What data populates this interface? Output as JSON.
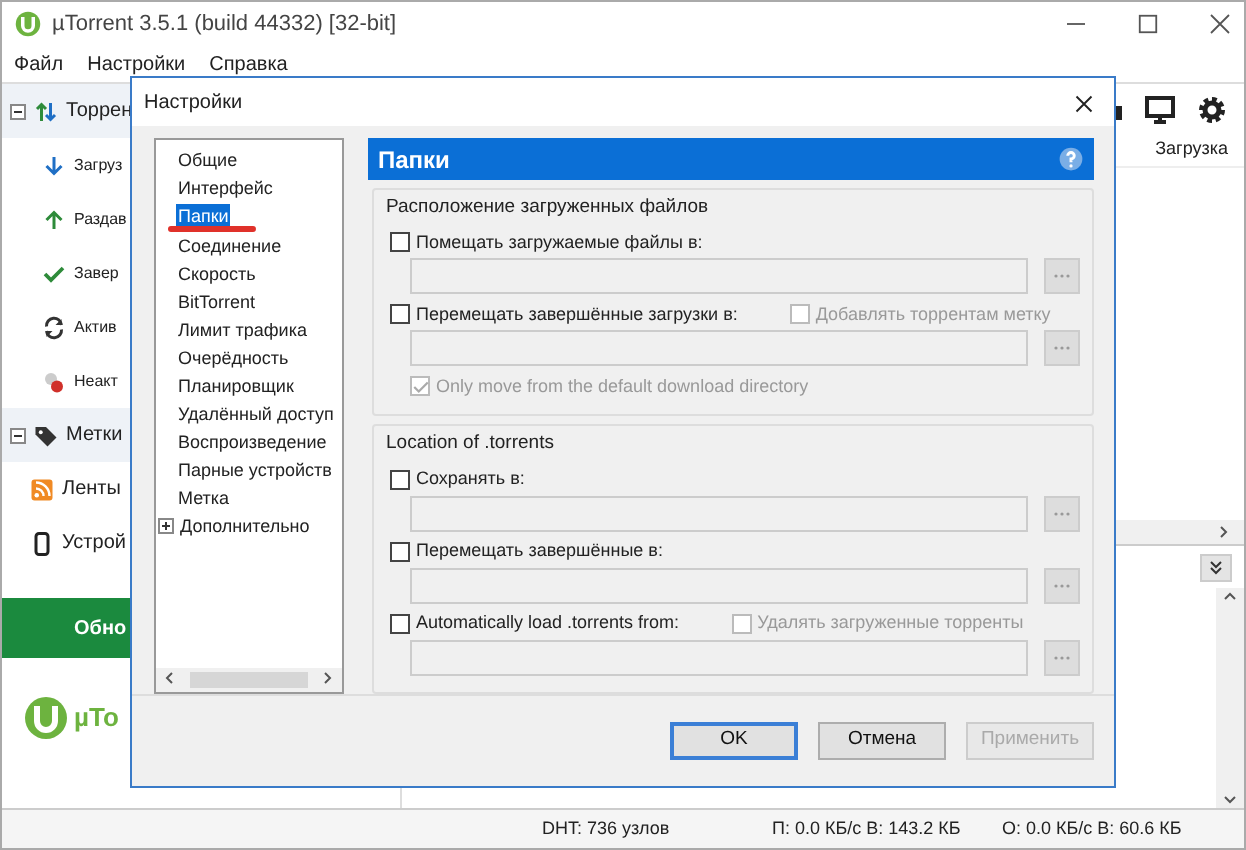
{
  "window": {
    "title": "µTorrent 3.5.1  (build 44332) [32-bit]"
  },
  "menu": [
    "Файл",
    "Настройки",
    "Справка"
  ],
  "sidebar": {
    "items": [
      {
        "label": "Торрен",
        "kind": "group"
      },
      {
        "label": "Загруз",
        "kind": "sub"
      },
      {
        "label": "Раздав",
        "kind": "sub"
      },
      {
        "label": "Завер",
        "kind": "sub"
      },
      {
        "label": "Актив",
        "kind": "sub"
      },
      {
        "label": "Неакт",
        "kind": "sub"
      },
      {
        "label": "Метки",
        "kind": "group"
      },
      {
        "label": "Ленты",
        "kind": "plain"
      },
      {
        "label": "Устрой",
        "kind": "plain"
      }
    ],
    "banner": "Обно",
    "logo": "µTo"
  },
  "list": {
    "columns": [
      "Загрузка"
    ]
  },
  "status_bar": [
    "DHT: 736 узлов",
    "П: 0.0 КБ/с В: 143.2 КБ",
    "О: 0.0 КБ/с В: 60.6 КБ"
  ],
  "dialog": {
    "title": "Настройки",
    "tree": [
      {
        "label": "Общие",
        "kind": "leaf",
        "selected": false
      },
      {
        "label": "Интерфейс",
        "kind": "leaf",
        "selected": false
      },
      {
        "label": "Папки",
        "kind": "leaf",
        "selected": true
      },
      {
        "label": "Соединение",
        "kind": "leaf",
        "selected": false
      },
      {
        "label": "Скорость",
        "kind": "leaf",
        "selected": false
      },
      {
        "label": "BitTorrent",
        "kind": "leaf",
        "selected": false
      },
      {
        "label": "Лимит трафика",
        "kind": "leaf",
        "selected": false
      },
      {
        "label": "Очерёдность",
        "kind": "leaf",
        "selected": false
      },
      {
        "label": "Планировщик",
        "kind": "leaf",
        "selected": false
      },
      {
        "label": "Удалённый доступ",
        "kind": "leaf",
        "selected": false
      },
      {
        "label": "Воспроизведение",
        "kind": "leaf",
        "selected": false
      },
      {
        "label": "Парные устройств",
        "kind": "leaf",
        "selected": false
      },
      {
        "label": "Метка",
        "kind": "leaf",
        "selected": false
      },
      {
        "label": "Дополнительно",
        "kind": "folder",
        "selected": false
      }
    ],
    "page_title": "Папки",
    "groups": [
      {
        "title": "Расположение загруженных файлов",
        "options": [
          {
            "kind": "path",
            "label": "Помещать загружаемые файлы в:",
            "checked": false,
            "disabled": false
          },
          {
            "kind": "path",
            "label": "Перемещать завершённые загрузки в:",
            "checked": false,
            "disabled": false,
            "side": {
              "label": "Добавлять торрентам метку",
              "checked": false,
              "disabled": true
            }
          },
          {
            "kind": "check",
            "label": "Only move from the default download directory",
            "checked": true,
            "disabled": true
          }
        ]
      },
      {
        "title": "Location of .torrents",
        "options": [
          {
            "kind": "path",
            "label": "Сохранять в:",
            "checked": false,
            "disabled": false
          },
          {
            "kind": "path",
            "label": "Перемещать завершённые в:",
            "checked": false,
            "disabled": false
          },
          {
            "kind": "path",
            "label": "Automatically load .torrents from:",
            "checked": false,
            "disabled": false,
            "side": {
              "label": "Удалять загруженные торренты",
              "checked": false,
              "disabled": true
            }
          }
        ]
      }
    ],
    "buttons": [
      {
        "label": "OK",
        "kind": "default",
        "disabled": false
      },
      {
        "label": "Отмена",
        "kind": "normal",
        "disabled": false
      },
      {
        "label": "Применить",
        "kind": "normal",
        "disabled": true
      }
    ]
  }
}
